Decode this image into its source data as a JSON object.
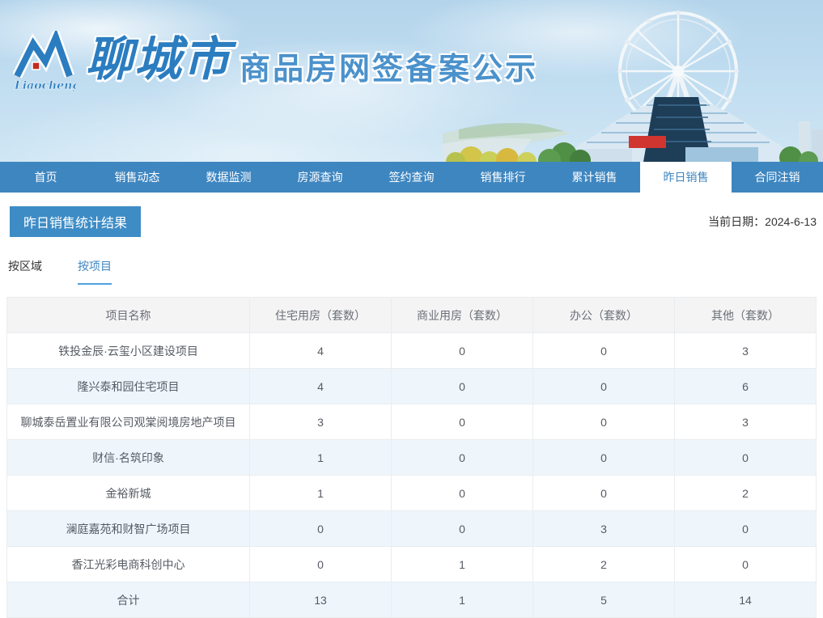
{
  "header": {
    "logo_text": "Liaocheng",
    "site_name": "聊城市",
    "site_subtitle": "商品房网签备案公示"
  },
  "nav": {
    "items": [
      {
        "label": "首页",
        "active": false
      },
      {
        "label": "销售动态",
        "active": false
      },
      {
        "label": "数据监测",
        "active": false
      },
      {
        "label": "房源查询",
        "active": false
      },
      {
        "label": "签约查询",
        "active": false
      },
      {
        "label": "销售排行",
        "active": false
      },
      {
        "label": "累计销售",
        "active": false
      },
      {
        "label": "昨日销售",
        "active": true
      },
      {
        "label": "合同注销",
        "active": false
      }
    ]
  },
  "page": {
    "title": "昨日销售统计结果",
    "date_label": "当前日期：",
    "date_value": "2024-6-13",
    "tabs": [
      {
        "label": "按区域",
        "active": false
      },
      {
        "label": "按项目",
        "active": true
      }
    ]
  },
  "table": {
    "columns": [
      "项目名称",
      "住宅用房（套数）",
      "商业用房（套数）",
      "办公（套数）",
      "其他（套数）"
    ],
    "rows": [
      [
        "铁投金辰·云玺小区建设项目",
        "4",
        "0",
        "0",
        "3"
      ],
      [
        "隆兴泰和园住宅项目",
        "4",
        "0",
        "0",
        "6"
      ],
      [
        "聊城泰岳置业有限公司观棠阅境房地产项目",
        "3",
        "0",
        "0",
        "3"
      ],
      [
        "财信·名筑印象",
        "1",
        "0",
        "0",
        "0"
      ],
      [
        "金裕新城",
        "1",
        "0",
        "0",
        "2"
      ],
      [
        "澜庭嘉苑和财智广场项目",
        "0",
        "0",
        "3",
        "0"
      ],
      [
        "香江光彩电商科创中心",
        "0",
        "1",
        "2",
        "0"
      ]
    ],
    "total_row": [
      "合计",
      "13",
      "1",
      "5",
      "14"
    ]
  },
  "colors": {
    "nav_bg": "#3e86c0",
    "accent_blue": "#3e86c0",
    "title_box_bg": "#3e8cc6",
    "tab_underline": "#4da3e0",
    "table_header_bg": "#f4f4f5",
    "row_alt_bg": "#eef6fc",
    "logo_red": "#c42a20"
  }
}
